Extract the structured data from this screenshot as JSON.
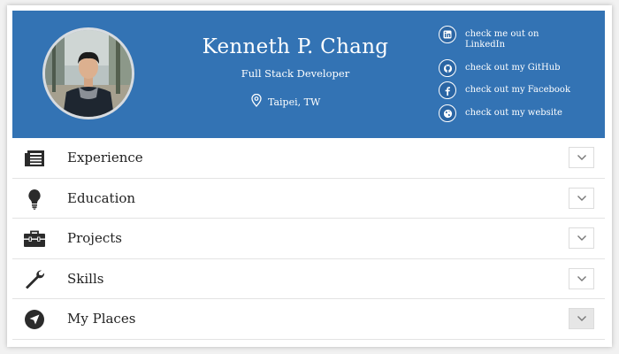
{
  "profile": {
    "name": "Kenneth P. Chang",
    "title": "Full Stack Developer",
    "location": "Taipei, TW"
  },
  "social": [
    {
      "icon": "linkedin-icon",
      "label": "check me out on LinkedIn"
    },
    {
      "icon": "github-icon",
      "label": "check out my GitHub"
    },
    {
      "icon": "facebook-icon",
      "label": "check out my Facebook"
    },
    {
      "icon": "globe-icon",
      "label": "check out my website"
    }
  ],
  "sections": [
    {
      "icon": "newspaper-icon",
      "label": "Experience"
    },
    {
      "icon": "lightbulb-icon",
      "label": "Education"
    },
    {
      "icon": "toolbox-icon",
      "label": "Projects"
    },
    {
      "icon": "wrench-icon",
      "label": "Skills"
    },
    {
      "icon": "compass-icon",
      "label": "My Places"
    }
  ],
  "colors": {
    "header": "#3373b4",
    "icon": "#2b2b2b"
  }
}
